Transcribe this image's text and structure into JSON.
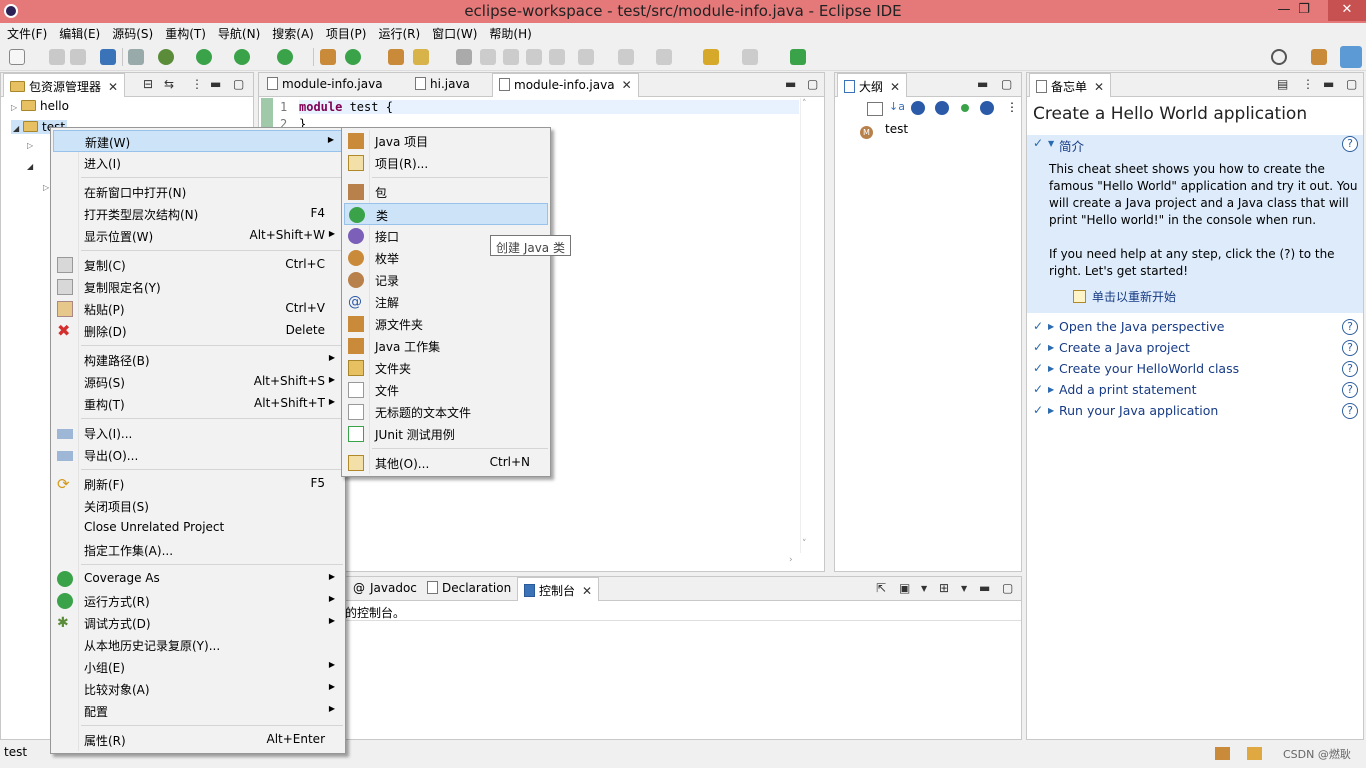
{
  "window": {
    "title": "eclipse-workspace - test/src/module-info.java - Eclipse IDE",
    "minimize": "—",
    "maximize": "❐",
    "close": "✕"
  },
  "menubar": [
    "文件(F)",
    "编辑(E)",
    "源码(S)",
    "重构(T)",
    "导航(N)",
    "搜索(A)",
    "项目(P)",
    "运行(R)",
    "窗口(W)",
    "帮助(H)"
  ],
  "package_explorer": {
    "tab": "包资源管理器",
    "projects": [
      "hello",
      "test"
    ]
  },
  "editor": {
    "tabs": [
      "module-info.java",
      "hi.java",
      "module-info.java"
    ],
    "lines": [
      {
        "num": "1",
        "kw": "module",
        "rest": " test {"
      },
      {
        "num": "2",
        "kw": "",
        "rest": "}"
      }
    ]
  },
  "outline": {
    "tab": "大纲",
    "item": "test"
  },
  "cheatsheet": {
    "tab": "备忘单",
    "title": "Create a Hello World application",
    "intro_heading": "简介",
    "intro_p1": "This cheat sheet shows you how to create the famous \"Hello World\" application and try it out. You will create a Java project and a Java class that will print \"Hello world!\" in the console when run.",
    "intro_p2": "If you need help at any step, click the (?) to the right. Let's get started!",
    "restart_link": "单击以重新开始",
    "steps": [
      "Open the Java perspective",
      "Create a Java project",
      "Create your HelloWorld class",
      "Add a print statement",
      "Run your Java application"
    ],
    "help_glyph": "?"
  },
  "bottom_panel": {
    "tabs": [
      "Javadoc",
      "Declaration",
      "控制台"
    ],
    "content_fragment": "的控制台。"
  },
  "context_menu": {
    "items": [
      {
        "label": "新建(W)",
        "shortcut": "",
        "submenu": true
      },
      {
        "label": "进入(I)",
        "shortcut": ""
      },
      {
        "label": "在新窗口中打开(N)",
        "shortcut": ""
      },
      {
        "label": "打开类型层次结构(N)",
        "shortcut": "F4"
      },
      {
        "label": "显示位置(W)",
        "shortcut": "Alt+Shift+W",
        "submenu": true
      },
      {
        "label": "复制(C)",
        "shortcut": "Ctrl+C"
      },
      {
        "label": "复制限定名(Y)",
        "shortcut": ""
      },
      {
        "label": "粘贴(P)",
        "shortcut": "Ctrl+V"
      },
      {
        "label": "删除(D)",
        "shortcut": "Delete"
      },
      {
        "label": "构建路径(B)",
        "shortcut": "",
        "submenu": true
      },
      {
        "label": "源码(S)",
        "shortcut": "Alt+Shift+S",
        "submenu": true
      },
      {
        "label": "重构(T)",
        "shortcut": "Alt+Shift+T",
        "submenu": true
      },
      {
        "label": "导入(I)...",
        "shortcut": ""
      },
      {
        "label": "导出(O)...",
        "shortcut": ""
      },
      {
        "label": "刷新(F)",
        "shortcut": "F5"
      },
      {
        "label": "关闭项目(S)",
        "shortcut": ""
      },
      {
        "label": "Close Unrelated Project",
        "shortcut": ""
      },
      {
        "label": "指定工作集(A)...",
        "shortcut": ""
      },
      {
        "label": "Coverage As",
        "shortcut": "",
        "submenu": true
      },
      {
        "label": "运行方式(R)",
        "shortcut": "",
        "submenu": true
      },
      {
        "label": "调试方式(D)",
        "shortcut": "",
        "submenu": true
      },
      {
        "label": "从本地历史记录复原(Y)...",
        "shortcut": ""
      },
      {
        "label": "小组(E)",
        "shortcut": "",
        "submenu": true
      },
      {
        "label": "比较对象(A)",
        "shortcut": "",
        "submenu": true
      },
      {
        "label": "配置",
        "shortcut": "",
        "submenu": true
      },
      {
        "label": "属性(R)",
        "shortcut": "Alt+Enter"
      }
    ]
  },
  "new_submenu": {
    "items": [
      {
        "label": "Java 项目",
        "shortcut": ""
      },
      {
        "label": "项目(R)...",
        "shortcut": ""
      },
      {
        "label": "包",
        "shortcut": ""
      },
      {
        "label": "类",
        "shortcut": ""
      },
      {
        "label": "接口",
        "shortcut": ""
      },
      {
        "label": "枚举",
        "shortcut": ""
      },
      {
        "label": "记录",
        "shortcut": ""
      },
      {
        "label": "注解",
        "shortcut": ""
      },
      {
        "label": "源文件夹",
        "shortcut": ""
      },
      {
        "label": "Java 工作集",
        "shortcut": ""
      },
      {
        "label": "文件夹",
        "shortcut": ""
      },
      {
        "label": "文件",
        "shortcut": ""
      },
      {
        "label": "无标题的文本文件",
        "shortcut": ""
      },
      {
        "label": "JUnit 测试用例",
        "shortcut": ""
      },
      {
        "label": "其他(O)...",
        "shortcut": "Ctrl+N"
      }
    ],
    "tooltip": "创建 Java 类"
  },
  "status": {
    "left": "test",
    "watermark": "CSDN @燃耿"
  },
  "colors": {
    "titlebar": "#e5797a",
    "highlight": "#cce3f8",
    "cheat_bg": "#ddebfa",
    "link": "#173b84",
    "keyword": "#7f0055"
  }
}
